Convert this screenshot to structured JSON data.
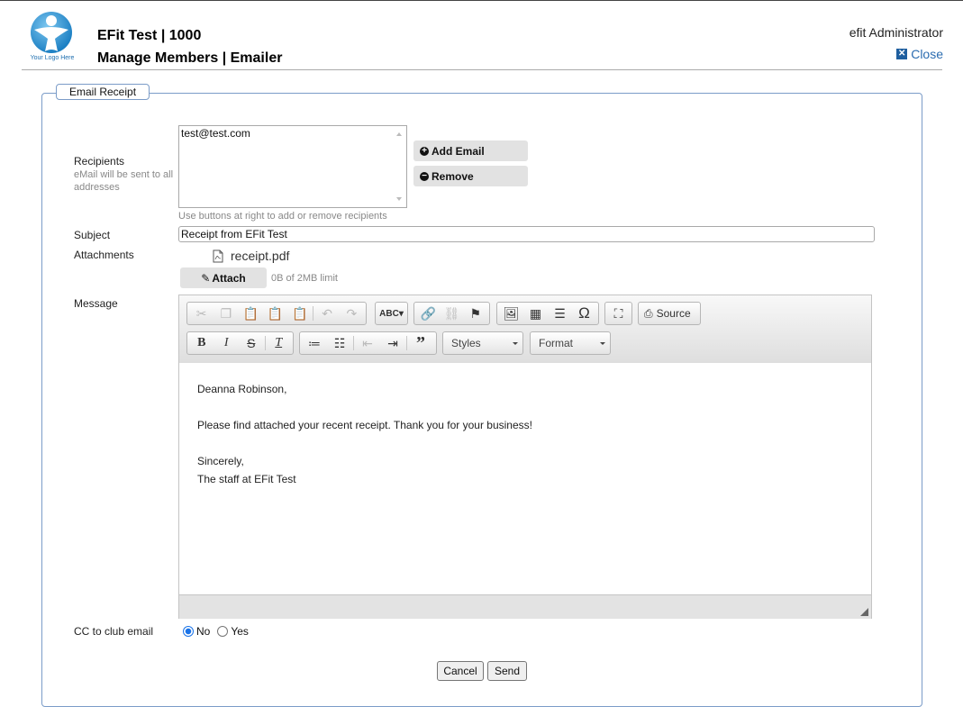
{
  "header": {
    "logo_text": "Your Logo Here",
    "title": "EFit Test | 1000",
    "subtitle": "Manage Members | Emailer",
    "user": "efit Administrator",
    "close_label": "Close"
  },
  "form": {
    "legend": "Email Receipt",
    "recipients": {
      "label": "Recipients",
      "hint": "eMail will be sent to all addresses",
      "values": [
        "test@test.com"
      ],
      "help": "Use buttons at right to add or remove recipients",
      "add_label": "Add Email",
      "remove_label": "Remove"
    },
    "subject": {
      "label": "Subject",
      "value": "Receipt from EFit Test"
    },
    "attachments": {
      "label": "Attachments",
      "files": [
        "receipt.pdf"
      ],
      "attach_label": "Attach",
      "limit": "0B of 2MB limit"
    },
    "message": {
      "label": "Message",
      "toolbar": {
        "source_label": "Source",
        "styles_label": "Styles",
        "format_label": "Format"
      },
      "lines": [
        "Deanna Robinson,",
        "Please find attached your recent receipt. Thank you for your business!",
        "Sincerely,",
        "The staff at EFit Test"
      ]
    },
    "cc": {
      "label": "CC to club email",
      "options": [
        "No",
        "Yes"
      ],
      "selected": "No"
    },
    "buttons": {
      "cancel": "Cancel",
      "send": "Send"
    }
  }
}
